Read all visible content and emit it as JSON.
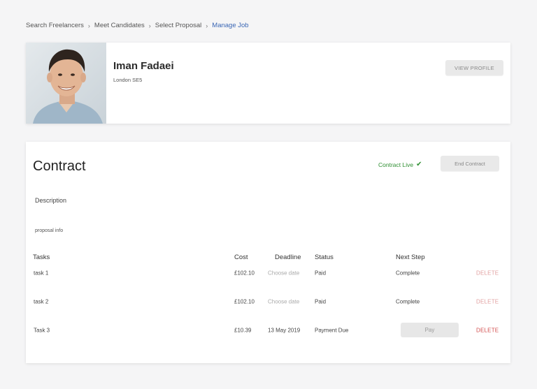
{
  "breadcrumb": [
    {
      "label": "Search Freelancers"
    },
    {
      "label": "Meet Candidates"
    },
    {
      "label": "Select Proposal"
    },
    {
      "label": "Manage Job"
    }
  ],
  "profile": {
    "name": "Iman Fadaei",
    "location": "London SE5",
    "view_profile_label": "VIEW PROFILE"
  },
  "contract": {
    "title": "Contract",
    "status": "Contract Live",
    "end_label": "End Contract",
    "description_label": "Description",
    "description_text": "proposal info"
  },
  "table": {
    "headers": {
      "tasks": "Tasks",
      "cost": "Cost",
      "deadline": "Deadline",
      "status": "Status",
      "next_step": "Next Step"
    },
    "rows": [
      {
        "task": "task 1",
        "cost": "£102.10",
        "deadline": "Choose date",
        "status": "Paid",
        "next_step": "Complete",
        "action": "DELETE"
      },
      {
        "task": "task 2",
        "cost": "£102.10",
        "deadline": "Choose date",
        "status": "Paid",
        "next_step": "Complete",
        "action": "DELETE"
      },
      {
        "task": "Task 3",
        "cost": "£10.39",
        "deadline": "13 May 2019",
        "status": "Payment Due",
        "next_step": "Pay",
        "action": "DELETE"
      }
    ]
  },
  "colors": {
    "link_active": "#3b67b5",
    "status_green": "#2f8f32",
    "delete_red": "#d24b4b"
  }
}
